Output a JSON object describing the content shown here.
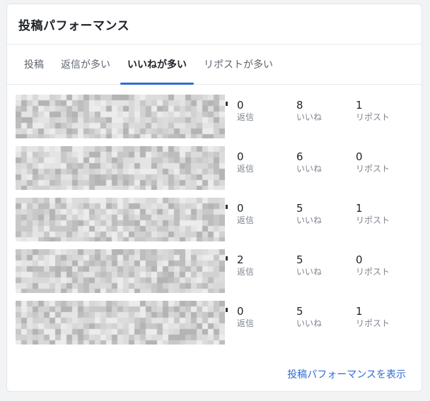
{
  "card": {
    "title": "投稿パフォーマンス"
  },
  "tabs": [
    {
      "label": "投稿",
      "active": false
    },
    {
      "label": "返信が多い",
      "active": false
    },
    {
      "label": "いいねが多い",
      "active": true
    },
    {
      "label": "リポストが多い",
      "active": false
    }
  ],
  "posts": [
    {
      "replies": "0",
      "likes": "8",
      "reposts": "1"
    },
    {
      "replies": "0",
      "likes": "6",
      "reposts": "0"
    },
    {
      "replies": "0",
      "likes": "5",
      "reposts": "1"
    },
    {
      "replies": "2",
      "likes": "5",
      "reposts": "0"
    },
    {
      "replies": "0",
      "likes": "5",
      "reposts": "1"
    }
  ],
  "stat_labels": {
    "replies": "返信",
    "likes": "いいね",
    "reposts": "リポスト"
  },
  "footer": {
    "link_label": "投稿パフォーマンスを表示"
  },
  "colors": {
    "accent": "#2e6bd8",
    "tab_underline": "#2e6bd8"
  }
}
